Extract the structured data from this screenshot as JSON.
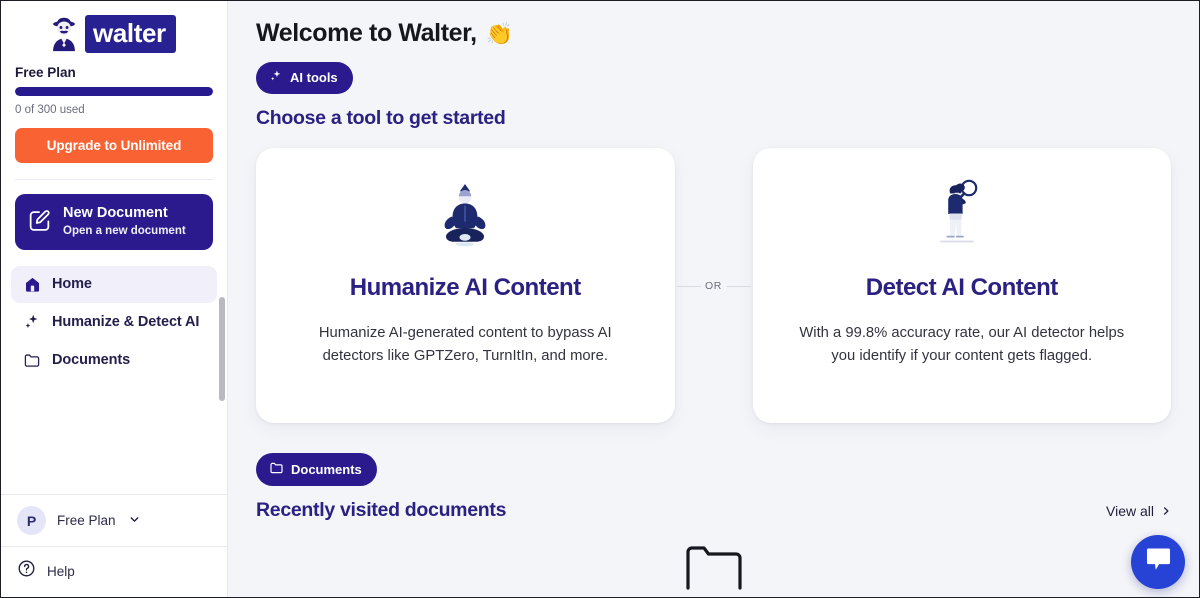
{
  "sidebar": {
    "logo": {
      "word": "walter",
      "mark_icon": "detective-icon"
    },
    "plan": {
      "name": "Free Plan",
      "usage": "0 of 300 used",
      "progress_percent": 100,
      "upgrade_label": "Upgrade to Unlimited",
      "upgrade_color": "#f96232"
    },
    "new_document": {
      "title": "New Document",
      "subtitle": "Open a new document",
      "icon": "pencil-square-icon"
    },
    "nav_items": [
      {
        "label": "Home",
        "icon": "home-icon",
        "active": true
      },
      {
        "label": "Humanize & Detect AI",
        "icon": "sparkle-icon",
        "active": false
      },
      {
        "label": "Documents",
        "icon": "folder-icon",
        "active": false
      }
    ],
    "account": {
      "avatar_letter": "P",
      "label": "Free Plan",
      "chevron": "chevron-down-icon"
    },
    "help": {
      "label": "Help",
      "icon": "question-circle-icon"
    }
  },
  "main": {
    "welcome_title": "Welcome to Walter,",
    "welcome_emoji": "👏",
    "ai_tools_pill": {
      "label": "AI tools",
      "icon": "sparkle-icon"
    },
    "section_heading": "Choose a tool to get started",
    "or_label": "OR",
    "cards": [
      {
        "title": "Humanize AI Content",
        "description": "Humanize AI-generated content to bypass AI detectors like GPTZero, TurnItIn, and more.",
        "illustration": "meditating-person-icon"
      },
      {
        "title": "Detect AI Content",
        "description": "With a 99.8% accuracy rate, our AI detector helps you identify if your content gets flagged.",
        "illustration": "person-with-magnifier-icon"
      }
    ],
    "documents_pill": {
      "label": "Documents",
      "icon": "folder-icon"
    },
    "documents_heading": "Recently visited documents",
    "view_all": {
      "label": "View all",
      "icon": "chevron-right-icon"
    },
    "empty_state_icon": "folder-outline-icon",
    "chat_fab": {
      "icon": "chat-bubble-icon",
      "color": "#2743d6"
    }
  },
  "theme": {
    "brand_navy": "#2a1a8e",
    "brand_indigo": "#2b2182",
    "accent_orange": "#f96232",
    "page_bg": "#f4f5f9",
    "card_bg": "#ffffff"
  }
}
